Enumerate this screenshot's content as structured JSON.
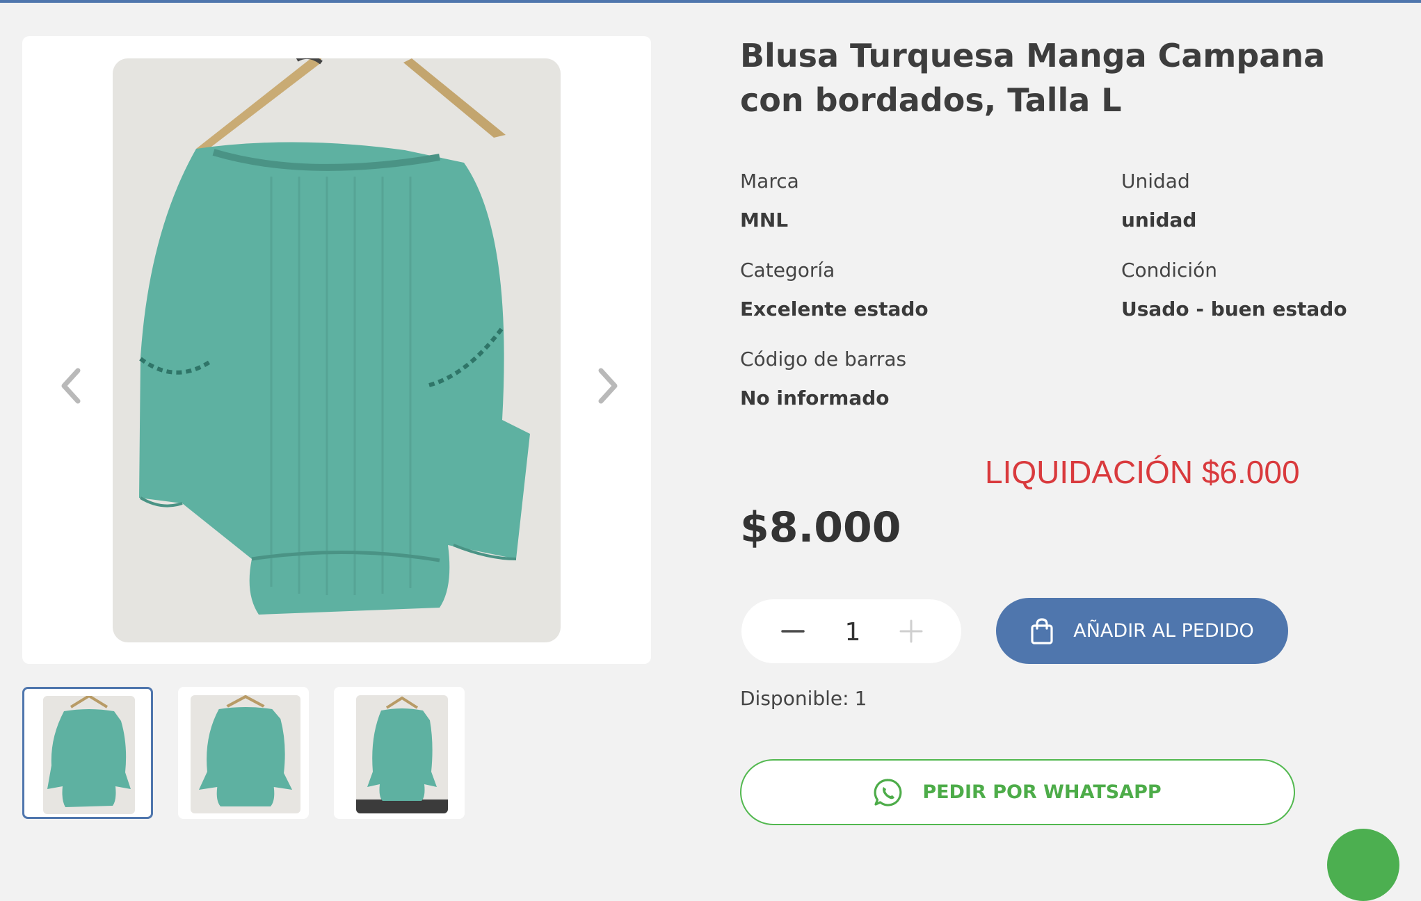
{
  "product": {
    "title": "Blusa Turquesa Manga Campana con bordados, Talla L",
    "attributes": [
      {
        "label": "Marca",
        "value": "MNL"
      },
      {
        "label": "Unidad",
        "value": "unidad"
      },
      {
        "label": "Categoría",
        "value": "Excelente estado"
      },
      {
        "label": "Condición",
        "value": "Usado - buen estado"
      },
      {
        "label": "Código de barras",
        "value": "No informado"
      }
    ],
    "promo": "LIQUIDACIÓN $6.000",
    "price": "$8.000",
    "quantity": "1",
    "stock_label": "Disponible:",
    "stock_value": "1"
  },
  "gallery": {
    "thumbnail_count": 3,
    "active_thumbnail": 1
  },
  "actions": {
    "add_to_order": "AÑADIR AL PEDIDO",
    "whatsapp_order": "PEDIR POR WHATSAPP"
  },
  "icons": [
    "chevron-left-icon",
    "chevron-right-icon",
    "minus-icon",
    "plus-icon",
    "shopping-bag-icon",
    "whatsapp-icon"
  ],
  "colors": {
    "accent": "#4f76ad",
    "promo": "#d93a3d",
    "whatsapp": "#4dac49",
    "background": "#f2f2f2"
  }
}
